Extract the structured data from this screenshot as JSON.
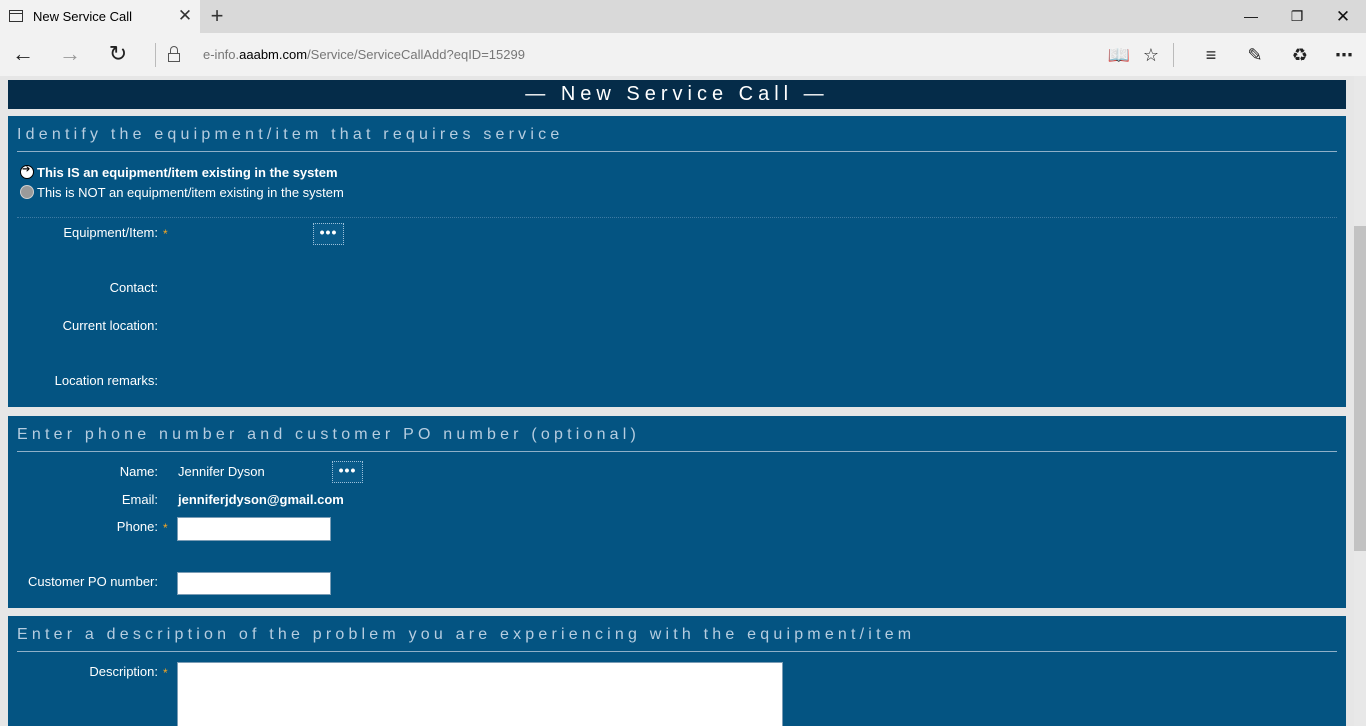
{
  "browser": {
    "tab_title": "New Service Call",
    "url_prefix": "e-info.",
    "url_domain": "aaabm.com",
    "url_path": "/Service/ServiceCallAdd?eqID=15299",
    "icons": [
      "tab-page-icon",
      "close-icon",
      "plus-icon",
      "minimize-icon",
      "restore-icon",
      "close-window-icon",
      "back-icon",
      "forward-icon",
      "refresh-icon",
      "lock-icon",
      "reading-view-icon",
      "star-icon",
      "hub-icon",
      "web-note-icon",
      "share-icon",
      "more-icon"
    ]
  },
  "page": {
    "header": "— New Service Call —"
  },
  "section_equipment": {
    "title": "Identify the equipment/item that requires service",
    "radio_existing": "This IS an equipment/item existing in the system",
    "radio_not_existing": "This is NOT an equipment/item existing in the system",
    "selected_radio": "existing",
    "equipment_label": "Equipment/Item:",
    "equipment_button": "•••",
    "contact_label": "Contact:",
    "location_label": "Current location:",
    "remarks_label": "Location remarks:",
    "required_mark": "*"
  },
  "section_phone": {
    "title": "Enter phone number and customer PO number (optional)",
    "name_label": "Name:",
    "name_value": "Jennifer Dyson",
    "name_button": "•••",
    "email_label": "Email:",
    "email_value": "jenniferjdyson@gmail.com",
    "phone_label": "Phone:",
    "phone_value": "",
    "po_label": "Customer PO number:",
    "po_value": "",
    "required_mark": "*"
  },
  "section_description": {
    "title": "Enter a description of the problem you are experiencing with the equipment/item",
    "description_label": "Description:",
    "description_value": "",
    "required_mark": "*"
  },
  "colors": {
    "header_bg": "#052c49",
    "panel_bg": "#045482",
    "required": "#f5a623"
  }
}
